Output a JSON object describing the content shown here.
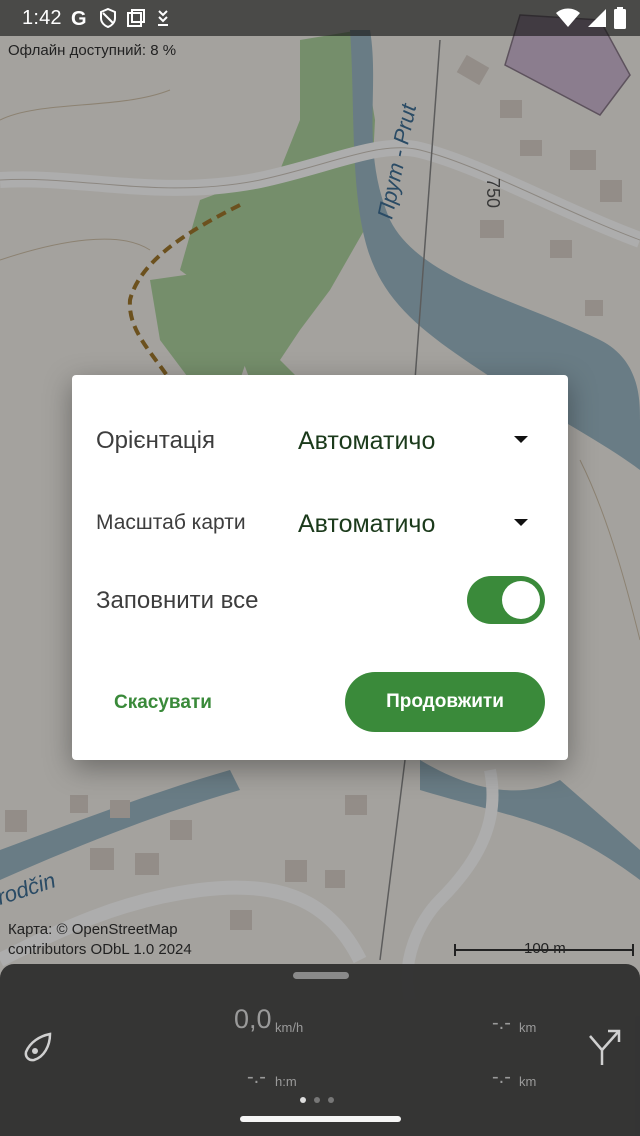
{
  "status_bar": {
    "time": "1:42",
    "icons": [
      "google-icon",
      "shield-icon",
      "screenshot-icon",
      "download-icon",
      "wifi-icon",
      "signal-icon",
      "battery-icon"
    ]
  },
  "map": {
    "offline_label": "Офлайн доступний: 8 %",
    "river_label": "Прут - Prut",
    "elevation_label": "750",
    "place_label": "rodčin",
    "attribution_line1": "Карта: © OpenStreetMap",
    "attribution_line2": "contributors ODbL 1.0 2024",
    "scale_label": "100 m",
    "colors": {
      "water": "#9bb7c4",
      "forest": "#add19e",
      "building": "#d9d0c9",
      "land": "#f2efe9"
    }
  },
  "dialog": {
    "orientation_label": "Орієнтація",
    "orientation_value": "Автоматичо",
    "scale_label": "Масштаб карти",
    "scale_value": "Автоматичо",
    "fill_label": "Заповнити все",
    "fill_enabled": true,
    "cancel_label": "Скасувати",
    "continue_label": "Продовжити",
    "accent_color": "#3a8a3a"
  },
  "bottom_panel": {
    "compass_icon": "compass-icon",
    "speed_value": "0,0",
    "speed_unit": "km/h",
    "time_value": "-.-",
    "time_unit": "h:m",
    "distance1_value": "-.-",
    "distance1_unit": "km",
    "distance2_value": "-.-",
    "distance2_unit": "km",
    "route_icon": "route-split-icon",
    "page_count": 3,
    "active_page": 1
  }
}
